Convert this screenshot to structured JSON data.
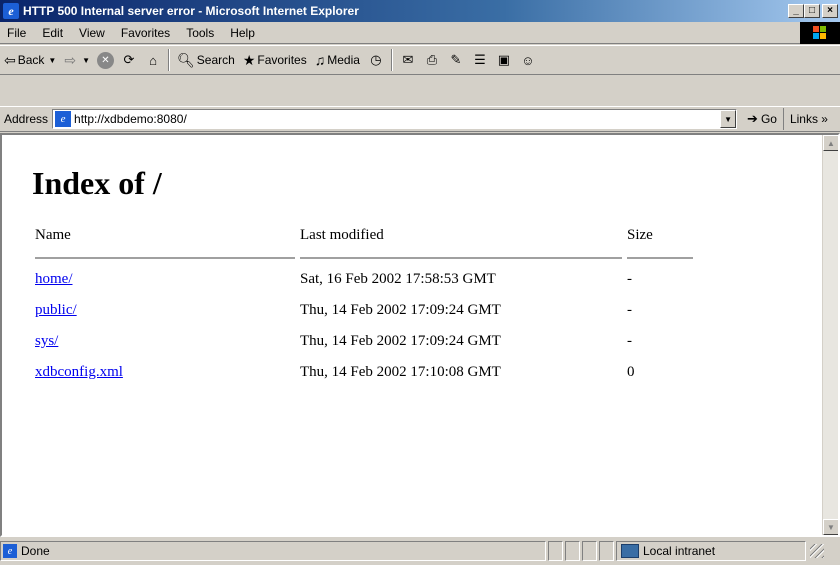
{
  "window": {
    "title": "HTTP 500 Internal server error - Microsoft Internet Explorer",
    "app_icon": "ie-icon",
    "minimize": "_",
    "maximize": "□",
    "close": "×"
  },
  "menu": {
    "items": [
      "File",
      "Edit",
      "View",
      "Favorites",
      "Tools",
      "Help"
    ]
  },
  "toolbar": {
    "back_label": "Back",
    "search_label": "Search",
    "favorites_label": "Favorites",
    "media_label": "Media"
  },
  "address": {
    "label": "Address",
    "url": "http://xdbdemo:8080/",
    "go_label": "Go",
    "links_label": "Links »"
  },
  "page": {
    "title": "Index of /",
    "headers": {
      "name": "Name",
      "modified": "Last modified",
      "size": "Size"
    },
    "rows": [
      {
        "name": "home/",
        "modified": "Sat, 16 Feb 2002 17:58:53 GMT",
        "size": "-"
      },
      {
        "name": "public/",
        "modified": "Thu, 14 Feb 2002 17:09:24 GMT",
        "size": "-"
      },
      {
        "name": "sys/",
        "modified": "Thu, 14 Feb 2002 17:09:24 GMT",
        "size": "-"
      },
      {
        "name": "xdbconfig.xml",
        "modified": "Thu, 14 Feb 2002 17:10:08 GMT",
        "size": "0"
      }
    ]
  },
  "status": {
    "text": "Done",
    "zone": "Local intranet"
  },
  "colors": {
    "title_bar_start": "#0a246a",
    "title_bar_end": "#a6caf0",
    "link": "#0000ee",
    "chrome": "#d4d0c8"
  }
}
